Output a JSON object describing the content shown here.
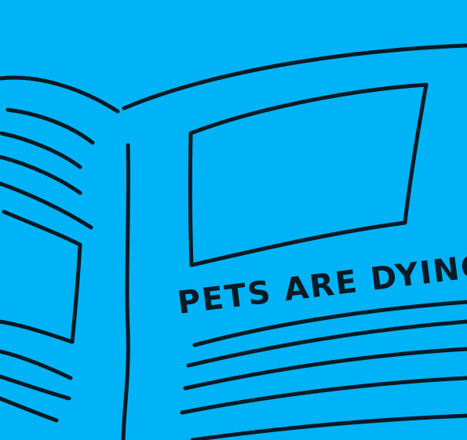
{
  "headline": "PETS ARE DYING",
  "colors": {
    "background": "#00b3f7",
    "ink": "#0a1a24"
  }
}
